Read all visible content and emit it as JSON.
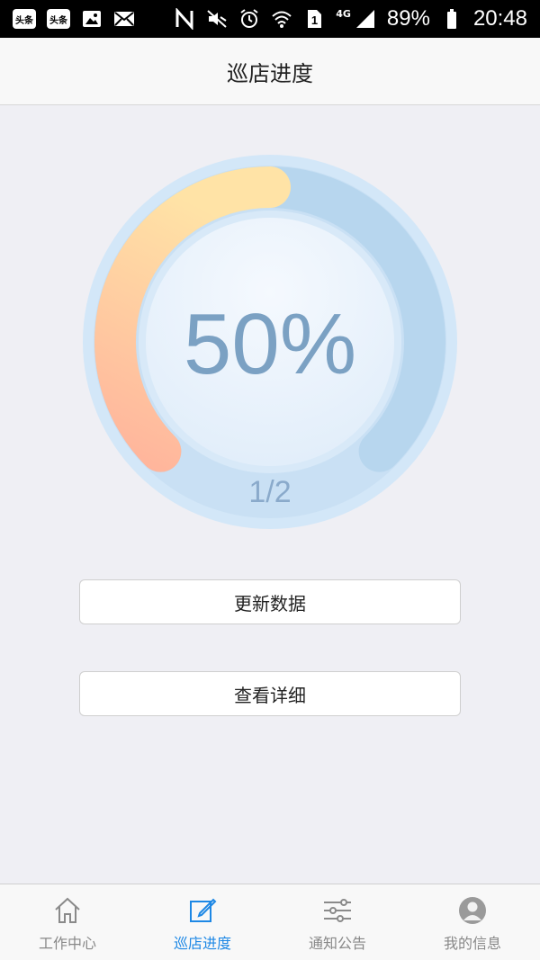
{
  "status_bar": {
    "app_icons": [
      "头条",
      "头条"
    ],
    "network": "4G",
    "battery": "89%",
    "time": "20:48"
  },
  "header": {
    "title": "巡店进度"
  },
  "progress": {
    "percent_text": "50%",
    "count_text": "1/2",
    "fraction": 0.5
  },
  "actions": {
    "update_label": "更新数据",
    "detail_label": "查看详细"
  },
  "tabs": [
    {
      "label": "工作中心",
      "icon": "home-icon",
      "active": false
    },
    {
      "label": "巡店进度",
      "icon": "edit-icon",
      "active": true
    },
    {
      "label": "通知公告",
      "icon": "sliders-icon",
      "active": false
    },
    {
      "label": "我的信息",
      "icon": "user-icon",
      "active": false
    }
  ],
  "colors": {
    "accent": "#1e88e5",
    "ring_track": "#b7d6ee",
    "ring_gradient_start": "#ffb59c",
    "ring_gradient_end": "#ffe3a6",
    "percent_text": "#7ba1c3"
  }
}
